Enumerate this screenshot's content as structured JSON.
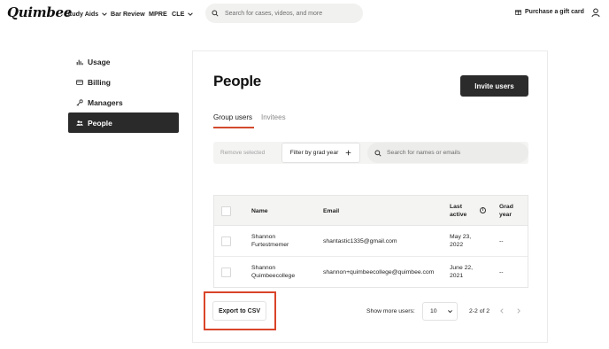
{
  "brand": {
    "logo": "Quimbee"
  },
  "nav": {
    "items": [
      {
        "label": "Study Aids",
        "dropdown": true
      },
      {
        "label": "Bar Review",
        "dropdown": false
      },
      {
        "label": "MPRE",
        "dropdown": false
      },
      {
        "label": "CLE",
        "dropdown": true
      }
    ],
    "search_placeholder": "Search for cases, videos, and more",
    "gift_label": "Purchase a gift card"
  },
  "sidebar": {
    "items": [
      {
        "label": "Usage",
        "icon": "bar-chart-icon",
        "active": false
      },
      {
        "label": "Billing",
        "icon": "credit-card-icon",
        "active": false
      },
      {
        "label": "Managers",
        "icon": "key-icon",
        "active": false
      },
      {
        "label": "People",
        "icon": "people-icon",
        "active": true
      }
    ]
  },
  "main": {
    "title": "People",
    "invite_label": "Invite users",
    "tabs": [
      {
        "label": "Group users",
        "active": true
      },
      {
        "label": "Invitees",
        "active": false
      }
    ],
    "filters": {
      "remove_label": "Remove selected",
      "grad_filter_label": "Filter by grad year",
      "search_placeholder": "Search for names or emails"
    },
    "table": {
      "headers": {
        "name": "Name",
        "email": "Email",
        "last_active": [
          "Last",
          "active"
        ],
        "grad_year": [
          "Grad",
          "year"
        ]
      },
      "rows": [
        {
          "name": [
            "Shannon",
            "Furtestmemer"
          ],
          "email": "shantastic1335@gmail.com",
          "last_active": [
            "May 23,",
            "2022"
          ],
          "grad_year": "--"
        },
        {
          "name": [
            "Shannon",
            "Quimbeecollege"
          ],
          "email": "shannon+quimbeecollege@quimbee.com",
          "last_active": [
            "June 22,",
            "2021"
          ],
          "grad_year": "--"
        }
      ]
    },
    "footer": {
      "export_label": "Export to CSV",
      "show_more_label": "Show more users:",
      "per_page": "10",
      "page_info": "2-2 of 2"
    }
  },
  "colors": {
    "accent": "#d24a2e",
    "highlight": "#d9442a",
    "dark": "#2b2b2b"
  }
}
